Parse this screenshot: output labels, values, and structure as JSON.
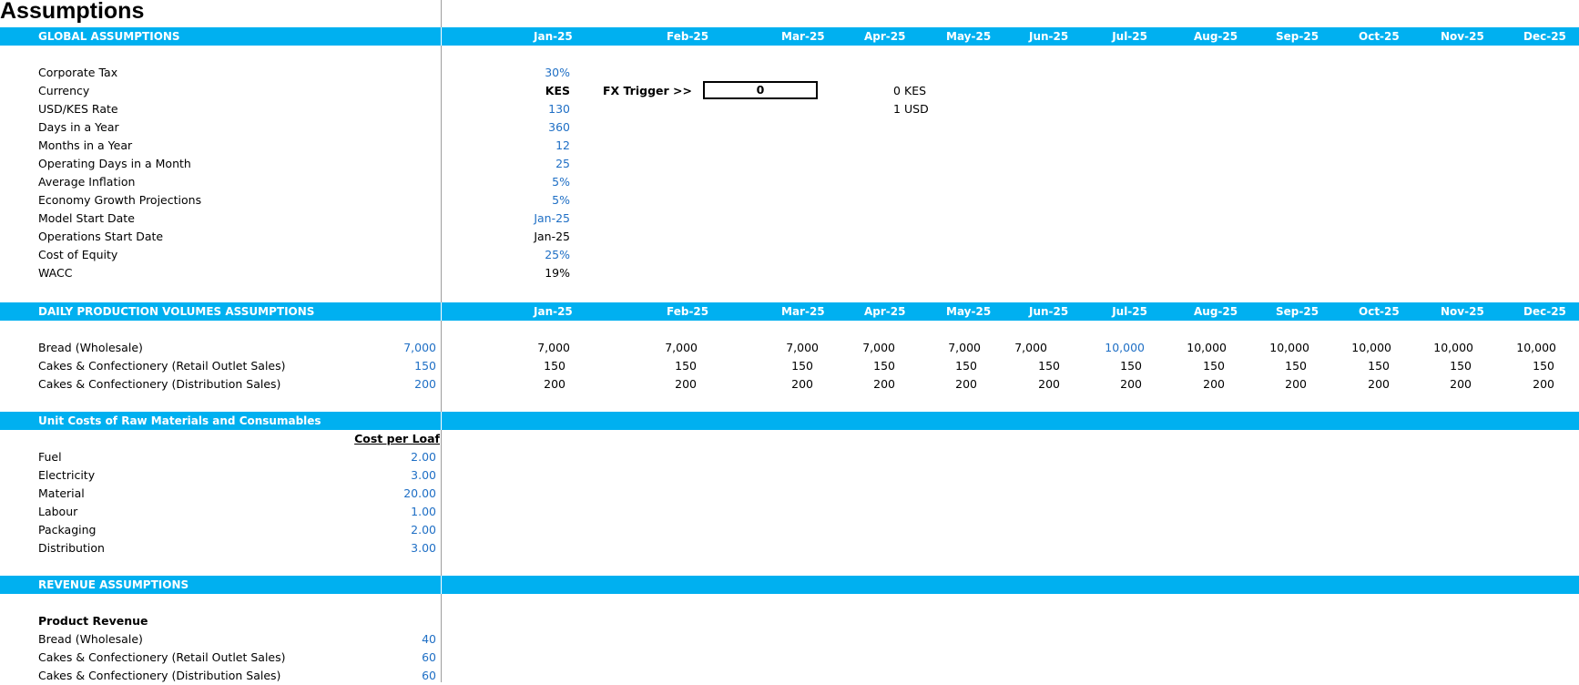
{
  "sheet": {
    "title": "Assumptions"
  },
  "months": [
    "Jan-25",
    "Feb-25",
    "Mar-25",
    "Apr-25",
    "May-25",
    "Jun-25",
    "Jul-25",
    "Aug-25",
    "Sep-25",
    "Oct-25",
    "Nov-25",
    "Dec-25"
  ],
  "global": {
    "header": "GLOBAL ASSUMPTIONS",
    "rows": [
      {
        "label": "Corporate Tax",
        "value": "30%"
      },
      {
        "label": "Currency",
        "value": "KES"
      },
      {
        "label": "USD/KES Rate",
        "value": "130"
      },
      {
        "label": "Days in a Year",
        "value": "360"
      },
      {
        "label": "Months in a Year",
        "value": "12"
      },
      {
        "label": "Operating Days in a Month",
        "value": "25"
      },
      {
        "label": "Average Inflation",
        "value": "5%"
      },
      {
        "label": "Economy Growth Projections",
        "value": "5%"
      },
      {
        "label": "Model Start Date",
        "value": "Jan-25"
      },
      {
        "label": "Operations Start Date",
        "value": "Jan-25"
      },
      {
        "label": "Cost of Equity",
        "value": "25%"
      },
      {
        "label": "WACC",
        "value": "19%"
      }
    ],
    "fx": {
      "trigger_label": "FX Trigger >>",
      "trigger_value": "0",
      "kes_num": "0",
      "kes_label": "KES",
      "usd_num": "1",
      "usd_label": "USD"
    }
  },
  "production": {
    "header": "DAILY PRODUCTION VOLUMES ASSUMPTIONS",
    "rows": [
      {
        "label": "Bread (Wholesale)",
        "base": "7,000",
        "values": [
          "7,000",
          "7,000",
          "7,000",
          "7,000",
          "7,000",
          "7,000",
          "10,000",
          "10,000",
          "10,000",
          "10,000",
          "10,000",
          "10,000"
        ]
      },
      {
        "label": "Cakes & Confectionery (Retail Outlet Sales)",
        "base": "150",
        "values": [
          "150",
          "150",
          "150",
          "150",
          "150",
          "150",
          "150",
          "150",
          "150",
          "150",
          "150",
          "150"
        ]
      },
      {
        "label": "Cakes & Confectionery (Distribution Sales)",
        "base": "200",
        "values": [
          "200",
          "200",
          "200",
          "200",
          "200",
          "200",
          "200",
          "200",
          "200",
          "200",
          "200",
          "200"
        ]
      }
    ]
  },
  "unit_costs": {
    "header": "Unit Costs of Raw Materials and Consumables",
    "col_header": "Cost per Loaf",
    "rows": [
      {
        "label": "Fuel",
        "value": "2.00"
      },
      {
        "label": "Electricity",
        "value": "3.00"
      },
      {
        "label": "Material",
        "value": "20.00"
      },
      {
        "label": "Labour",
        "value": "1.00"
      },
      {
        "label": "Packaging",
        "value": "2.00"
      },
      {
        "label": "Distribution",
        "value": "3.00"
      }
    ]
  },
  "revenue": {
    "header": "REVENUE ASSUMPTIONS",
    "subheader": "Product Revenue",
    "rows": [
      {
        "label": "Bread (Wholesale)",
        "value": "40"
      },
      {
        "label": "Cakes & Confectionery (Retail Outlet Sales)",
        "value": "60"
      },
      {
        "label": "Cakes & Confectionery (Distribution Sales)",
        "value": "60"
      }
    ]
  },
  "colors": {
    "band": "#00b0f0",
    "input_blue": "#1f6fc5",
    "grid_line": "#9e9e9e"
  }
}
